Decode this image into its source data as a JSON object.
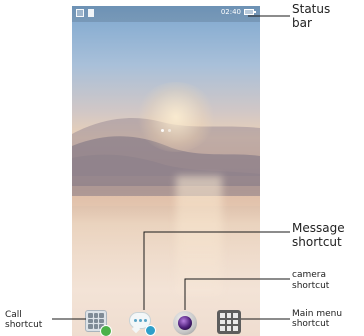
{
  "status_bar": {
    "time": "02:40",
    "signal_icon": "sim-icon",
    "notification_icon": "document-icon",
    "battery_icon": "battery-icon"
  },
  "dock": {
    "call_icon": "dialpad-phone-icon",
    "message_icon": "chat-bubble-icon",
    "camera_icon": "camera-lens-icon",
    "main_menu_icon": "app-grid-icon"
  },
  "annotations": {
    "status_bar": "Status\nbar",
    "message_shortcut": "Message\nshortcut",
    "camera_shortcut": "camera\nshortcut",
    "main_menu_shortcut": "Main menu\nshortcut",
    "call_shortcut": "Call\nshortcut"
  },
  "colors": {
    "leader_line": "#1a1a1a",
    "label_text": "#222222"
  }
}
